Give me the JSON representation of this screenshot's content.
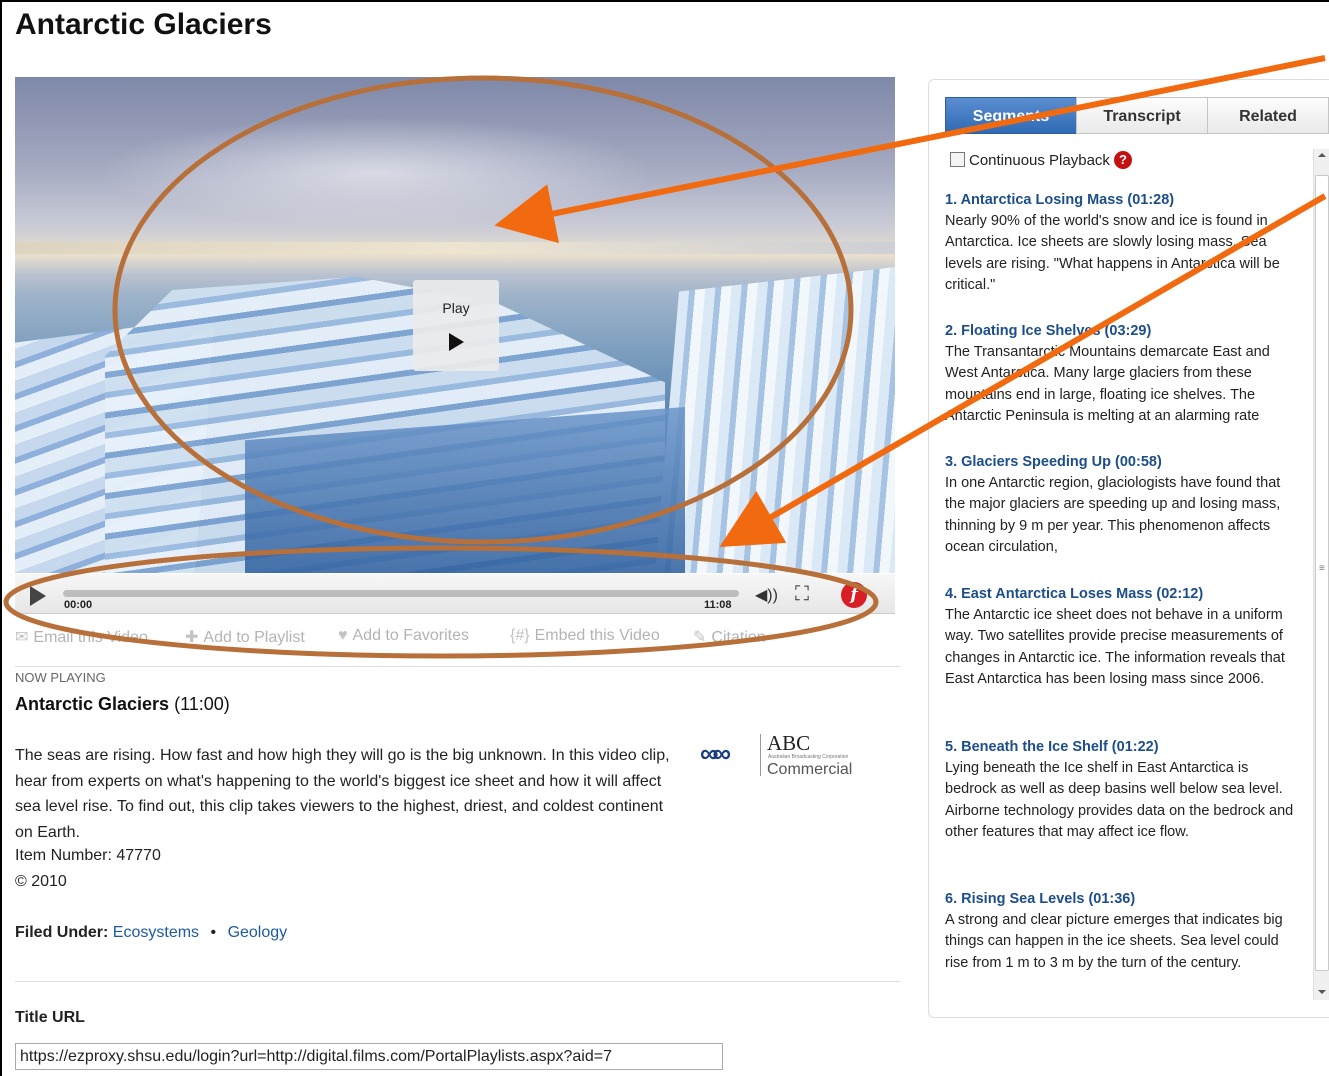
{
  "page": {
    "title": "Antarctic Glaciers"
  },
  "player": {
    "play_label": "Play",
    "current_time": "00:00",
    "total_time": "11:08",
    "progress": 0
  },
  "actions": [
    {
      "label": "Email this Video",
      "icon": "email-icon"
    },
    {
      "label": "Add to Playlist",
      "icon": "plus-icon"
    },
    {
      "label": "Add to Favorites",
      "icon": "heart-icon"
    },
    {
      "label": "Embed this Video",
      "icon": "embed-icon"
    },
    {
      "label": "Citation",
      "icon": "citation-icon"
    }
  ],
  "now_playing": {
    "label": "NOW PLAYING",
    "title": "Antarctic Glaciers",
    "duration": "(11:00)",
    "description": "The seas are rising. How fast and how high they will go is the big unknown. In this video clip, hear from experts on what's happening to the world's biggest ice sheet and how it will affect sea level rise. To find out, this clip takes viewers to the highest, driest, and coldest continent on Earth.",
    "item_number": "Item Number: 47770",
    "copyright": "© 2010"
  },
  "publisher": {
    "name": "ABC",
    "subtitle": "Australian Broadcasting Corporation",
    "division": "Commercial"
  },
  "filed_under": {
    "label": "Filed Under:",
    "categories": [
      "Ecosystems",
      "Geology"
    ],
    "separator": "•"
  },
  "title_url": {
    "label": "Title URL",
    "value": "https://ezproxy.shsu.edu/login?url=http://digital.films.com/PortalPlaylists.aspx?aid=7"
  },
  "panel": {
    "tabs": [
      "Segments",
      "Transcript",
      "Related"
    ],
    "active_tab": "Segments",
    "continuous_playback": "Continuous Playback",
    "segments": [
      {
        "title": "1. Antarctica Losing Mass (01:28)",
        "text": "Nearly 90% of the world's snow and ice is found in Antarctica. Ice sheets are slowly losing mass. Sea levels are rising. \"What happens in Antarctica will be critical.\""
      },
      {
        "title": "2. Floating Ice Shelves (03:29)",
        "text": "The Transantarctic Mountains demarcate East and West Antarctica. Many large glaciers from these mountains end in large, floating ice shelves. The Antarctic Peninsula is melting at an alarming rate"
      },
      {
        "title": "3. Glaciers Speeding Up (00:58)",
        "text": "In one Antarctic region, glaciologists have found that the major glaciers are speeding up and losing mass, thinning by 9 m per year. This phenomenon affects ocean circulation,"
      },
      {
        "title": "4. East Antarctica Loses Mass (02:12)",
        "text": "The Antarctic ice sheet does not behave in a uniform way. Two satellites provide precise measurements of changes in Antarctic ice. The information reveals that East Antarctica has been losing mass since 2006."
      },
      {
        "title": "5. Beneath the Ice Shelf (01:22)",
        "text": "Lying beneath the Ice shelf in East Antarctica is bedrock as well as deep basins well below sea level. Airborne technology provides data on the bedrock and other features that may affect ice flow."
      },
      {
        "title": "6. Rising Sea Levels (01:36)",
        "text": "A strong and clear picture emerges that indicates big things can happen in the ice sheets. Sea level could rise from 1 m to 3 m by the turn of the century."
      }
    ]
  },
  "colors": {
    "link": "#1d5aa0",
    "segment_title": "#1d4e8a",
    "tab_active": "#2f6bb4",
    "annotation": "#b8703a",
    "arrow": "#f26a10",
    "help_badge": "#c41010",
    "films_logo": "#d81f26"
  }
}
